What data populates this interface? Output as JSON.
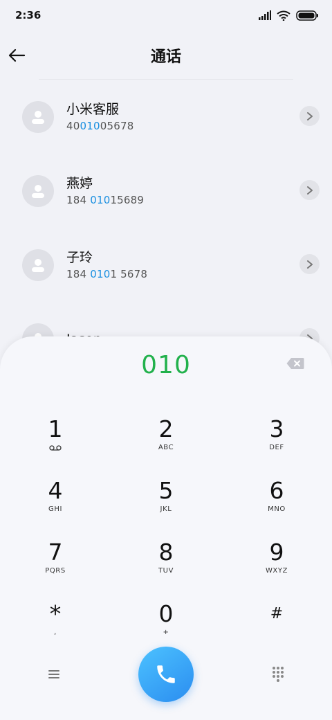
{
  "status": {
    "time": "2:36"
  },
  "header": {
    "title": "通话"
  },
  "contacts": [
    {
      "name": "小米客服",
      "number_pre": "40",
      "number_hl": "010",
      "number_post": "05678"
    },
    {
      "name": "燕婷",
      "number_pre": "184 ",
      "number_hl": "010",
      "number_post": "15689"
    },
    {
      "name": "子玲",
      "number_pre": "184 ",
      "number_hl": "010",
      "number_post": "1 5678"
    },
    {
      "name": "Jason",
      "number_pre": "",
      "number_hl": "",
      "number_post": ""
    }
  ],
  "dialpad": {
    "entered": "010",
    "keys": [
      {
        "digit": "1",
        "letters": ""
      },
      {
        "digit": "2",
        "letters": "ABC"
      },
      {
        "digit": "3",
        "letters": "DEF"
      },
      {
        "digit": "4",
        "letters": "GHI"
      },
      {
        "digit": "5",
        "letters": "JKL"
      },
      {
        "digit": "6",
        "letters": "MNO"
      },
      {
        "digit": "7",
        "letters": "PQRS"
      },
      {
        "digit": "8",
        "letters": "TUV"
      },
      {
        "digit": "9",
        "letters": "WXYZ"
      },
      {
        "digit": "*",
        "letters": ","
      },
      {
        "digit": "0",
        "letters": "+"
      },
      {
        "digit": "#",
        "letters": ""
      }
    ]
  },
  "colors": {
    "accent": "#1a8fe0",
    "entered": "#22b14c",
    "call": "#2b8df0"
  }
}
